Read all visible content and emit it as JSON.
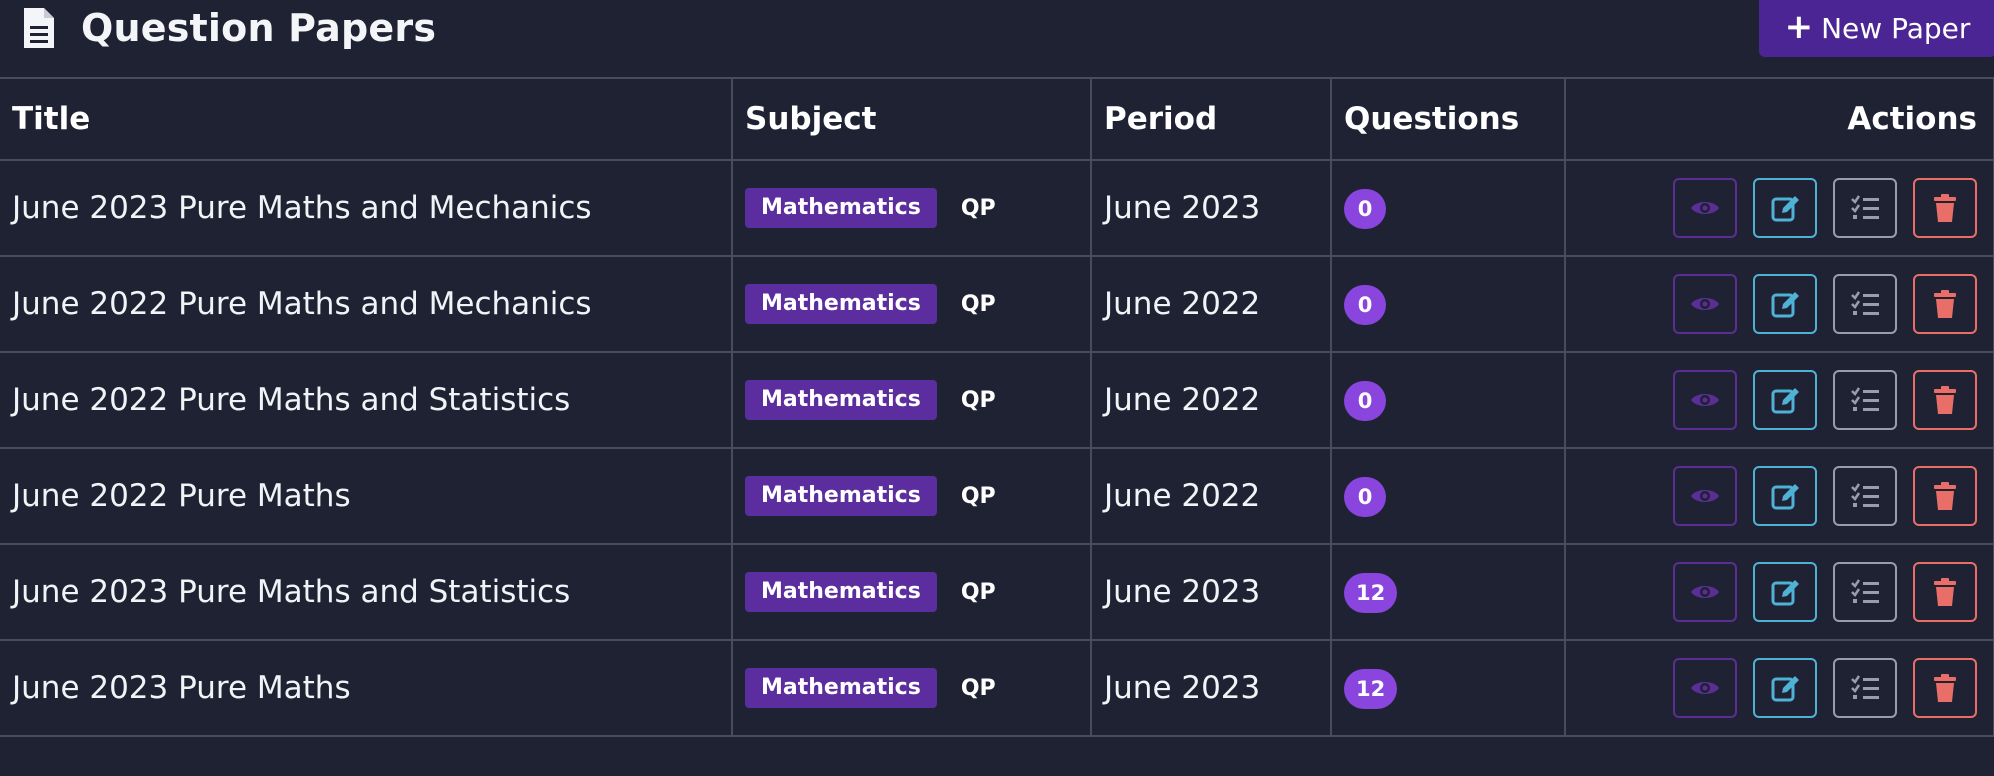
{
  "header": {
    "title": "Question Papers",
    "new_button_label": "New Paper"
  },
  "table": {
    "columns": [
      "Title",
      "Subject",
      "Period",
      "Questions",
      "Actions"
    ],
    "rows": [
      {
        "title": "June 2023 Pure Maths and Mechanics",
        "subject": "Mathematics",
        "type": "QP",
        "period": "June 2023",
        "questions": "0"
      },
      {
        "title": "June 2022 Pure Maths and Mechanics",
        "subject": "Mathematics",
        "type": "QP",
        "period": "June 2022",
        "questions": "0"
      },
      {
        "title": "June 2022 Pure Maths and Statistics",
        "subject": "Mathematics",
        "type": "QP",
        "period": "June 2022",
        "questions": "0"
      },
      {
        "title": "June 2022 Pure Maths",
        "subject": "Mathematics",
        "type": "QP",
        "period": "June 2022",
        "questions": "0"
      },
      {
        "title": "June 2023 Pure Maths and Statistics",
        "subject": "Mathematics",
        "type": "QP",
        "period": "June 2023",
        "questions": "12"
      },
      {
        "title": "June 2023 Pure Maths",
        "subject": "Mathematics",
        "type": "QP",
        "period": "June 2023",
        "questions": "12"
      }
    ],
    "action_icons": [
      "eye-icon",
      "edit-icon",
      "list-check-icon",
      "trash-icon"
    ]
  },
  "colors": {
    "background": "#1f2233",
    "primary_button": "#4a2593",
    "subject_badge": "#5b2d9e",
    "count_pill": "#8a45df",
    "view_accent": "#6b3aa8",
    "edit_accent": "#4fb1d6",
    "list_accent": "#9a9caa",
    "delete_accent": "#e96e67"
  }
}
